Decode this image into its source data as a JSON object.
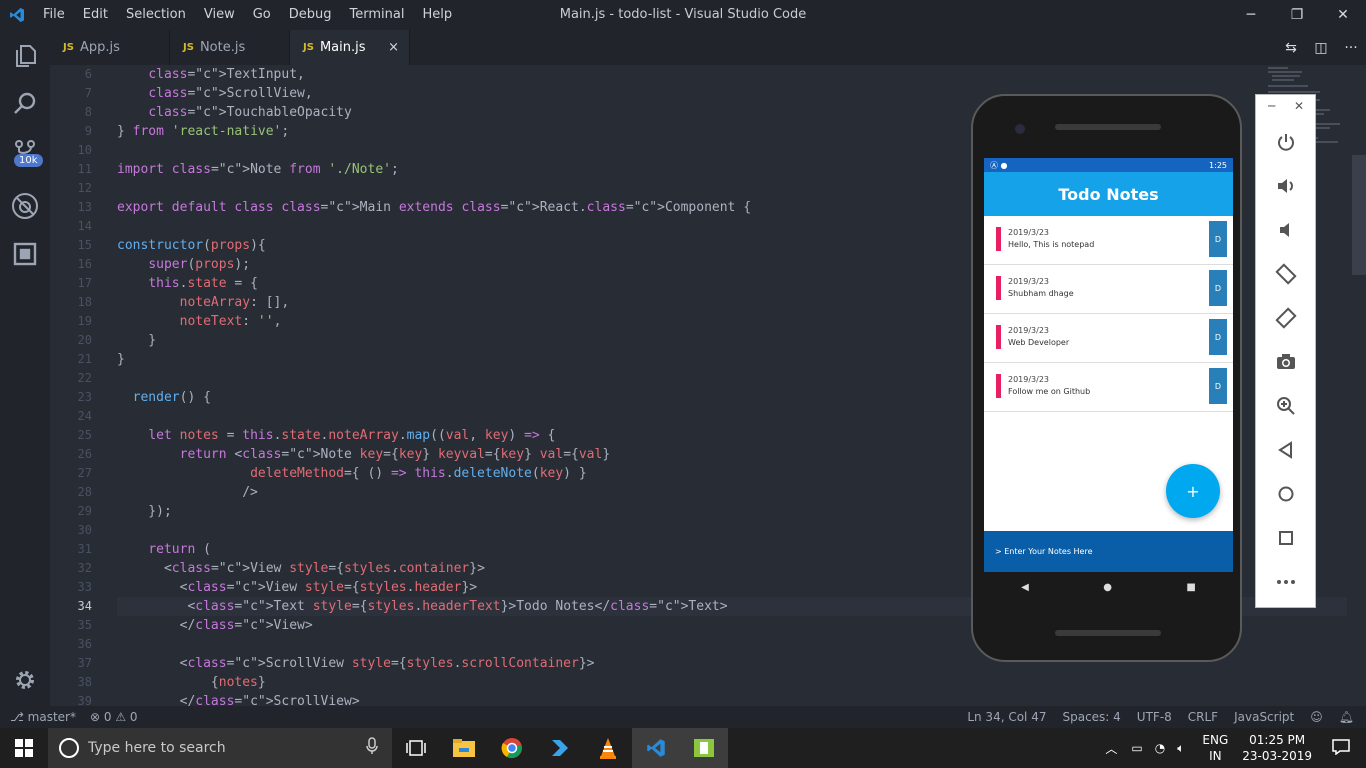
{
  "window": {
    "title": "Main.js - todo-list - Visual Studio Code"
  },
  "menu": [
    "File",
    "Edit",
    "Selection",
    "View",
    "Go",
    "Debug",
    "Terminal",
    "Help"
  ],
  "activity": {
    "badge": "10k"
  },
  "tabs": [
    {
      "label": "App.js",
      "tag": "JS"
    },
    {
      "label": "Note.js",
      "tag": "JS"
    },
    {
      "label": "Main.js",
      "tag": "JS",
      "close": "×"
    }
  ],
  "editor": {
    "line_numbers": [
      "6",
      "7",
      "8",
      "9",
      "10",
      "11",
      "12",
      "13",
      "14",
      "15",
      "16",
      "17",
      "18",
      "19",
      "20",
      "21",
      "22",
      "23",
      "24",
      "25",
      "26",
      "27",
      "28",
      "29",
      "30",
      "31",
      "32",
      "33",
      "34",
      "35",
      "36",
      "37",
      "38",
      "39"
    ],
    "lines": [
      "    TextInput,",
      "    ScrollView,",
      "    TouchableOpacity",
      "} from 'react-native';",
      "",
      "import Note from './Note';",
      "",
      "export default class Main extends React.Component {",
      "",
      "constructor(props){",
      "    super(props);",
      "    this.state = {",
      "        noteArray: [],",
      "        noteText: '',",
      "    }",
      "}",
      "",
      "  render() {",
      "",
      "    let notes = this.state.noteArray.map((val, key) => {",
      "        return <Note key={key} keyval={key} val={val}",
      "                 deleteMethod={ () => this.deleteNote(key) }",
      "                />",
      "    });",
      "",
      "    return (",
      "      <View style={styles.container}>",
      "        <View style={styles.header}>",
      "         <Text style={styles.headerText}>Todo Notes</Text>",
      "        </View>",
      "",
      "        <ScrollView style={styles.scrollContainer}>",
      "            {notes}",
      "        </ScrollView>"
    ]
  },
  "status": {
    "branch": "master*",
    "errors": "0",
    "warnings": "0",
    "position": "Ln 34, Col 47",
    "spaces": "Spaces: 4",
    "encoding": "UTF-8",
    "eol": "CRLF",
    "language": "JavaScript"
  },
  "phone": {
    "time": "1:25",
    "app_title": "Todo Notes",
    "notes": [
      {
        "date": "2019/3/23",
        "text": "Hello, This is notepad",
        "del": "D"
      },
      {
        "date": "2019/3/23",
        "text": "Shubham dhage",
        "del": "D"
      },
      {
        "date": "2019/3/23",
        "text": "Web Developer",
        "del": "D"
      },
      {
        "date": "2019/3/23",
        "text": "Follow me on Github",
        "del": "D"
      }
    ],
    "fab": "+",
    "input_placeholder": "> Enter Your Notes Here"
  },
  "taskbar": {
    "search_placeholder": "Type here to search",
    "lang_top": "ENG",
    "lang_bottom": "IN",
    "time": "01:25 PM",
    "date": "23-03-2019"
  },
  "colors": {
    "accent": "#4d78cc",
    "app_header": "#16a2e8",
    "note_bar": "#e91e63"
  }
}
